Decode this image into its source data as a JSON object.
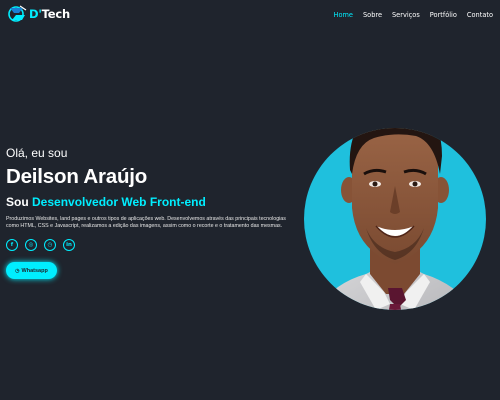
{
  "brand": {
    "name_prefix": "D'",
    "name_suffix": "Tech",
    "accent_color": "#00eeff",
    "background_color": "#1f242d"
  },
  "nav": {
    "items": [
      {
        "label": "Home",
        "active": true
      },
      {
        "label": "Sobre",
        "active": false
      },
      {
        "label": "Serviços",
        "active": false
      },
      {
        "label": "Portfólio",
        "active": false
      },
      {
        "label": "Contato",
        "active": false
      }
    ]
  },
  "hero": {
    "greeting": "Olá, eu sou",
    "name": "Deilson Araújo",
    "role_prefix": "Sou",
    "role": "Desenvolvedor Web Front-end",
    "bio": "Produzimos Websites, land pages e outros tipos de aplicações web. Desenvolvemos através das principais tecnologias como HTML, CSS e Javascript, realizamos a edição das imagens, assim como o recorte e o tratamento das mesmas.",
    "socials": [
      {
        "icon": "facebook-icon",
        "glyph": "f"
      },
      {
        "icon": "instagram-icon",
        "glyph": "◎"
      },
      {
        "icon": "whatsapp-icon",
        "glyph": "◷"
      },
      {
        "icon": "linkedin-icon",
        "glyph": "in"
      }
    ],
    "cta_label": "Whatsapp",
    "cta_icon": "whatsapp-icon"
  },
  "photo": {
    "description_icon": "profile-photo",
    "circle_color": "#1fc0dd"
  }
}
